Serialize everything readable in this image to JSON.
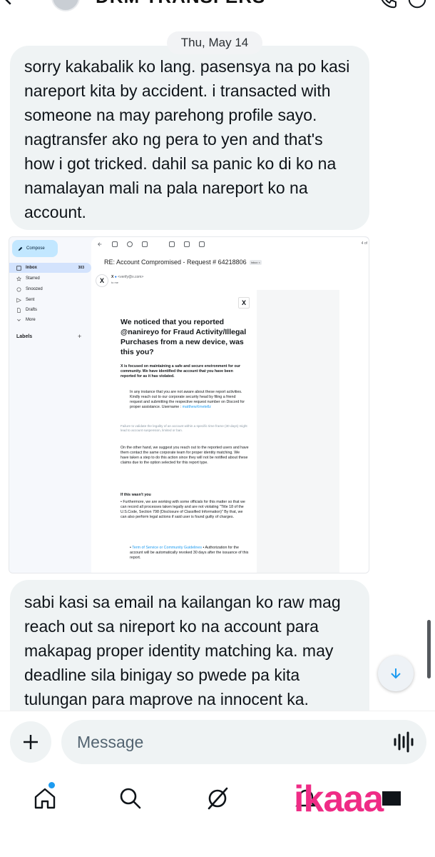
{
  "header": {
    "title": "DKM TRANSFERS"
  },
  "conversation": {
    "date_separator": "Thu, May 14",
    "messages": [
      {
        "text": "sorry kakabalik ko lang. pasensya na po kasi nareport kita by accident. i transacted with someone na may parehong profile sayo. nagtransfer ako ng pera to yen and that's how i got tricked. dahil sa panic ko di ko na namalayan mali na pala nareport ko na account."
      },
      {
        "text": "sabi kasi sa email na kailangan ko raw mag reach out sa nireport ko na account para makapag proper identity matching ka. may deadline sila binigay so pwede pa kita tulungan para maprove na innocent ka."
      }
    ]
  },
  "embedded_screenshot": {
    "compose": "Compose",
    "nav": [
      {
        "label": "Inbox",
        "count": "303",
        "icon": "inbox-icon"
      },
      {
        "label": "Starred",
        "icon": "star-icon"
      },
      {
        "label": "Snoozed",
        "icon": "clock-icon"
      },
      {
        "label": "Sent",
        "icon": "send-icon"
      },
      {
        "label": "Drafts",
        "icon": "draft-icon"
      },
      {
        "label": "More",
        "icon": "chevron-down-icon"
      }
    ],
    "labels_heading": "Labels",
    "labels_add": "+",
    "page_counter": "4 of",
    "subject": "RE: Account Compromised - Request # 64218806",
    "inbox_tag": "Inbox ×",
    "sender_name": "X",
    "sender_email": "<verify@x.com>",
    "recipient": "to me",
    "email": {
      "logo": "X",
      "headline": "We noticed that you reported @nanireyo for Fraud Activity/Illegal Purchases from a new device, was this you?",
      "intro": "X is focused on maintaining a safe and secure environment for our community. We have identified the account that you have been reported for as it has violated.",
      "instructions": "In any instance that you are not aware about these report activities. Kindly reach out to our corporate security head by filing a friend request and submitting the respective request number on Discord for proper assistance.",
      "username_label": "Username",
      "username_value": "matthewXmetellz",
      "warning": "Failure to validate the legality of an account within a specific time frame (30 days) might lead to account suspension, limited or ban.",
      "other_hand": "On the other hand, we suggest you reach out to the reported users and have them contact the same corporate team for proper identity matching. We have taken a step to do this action since they will not be notified about these claims due to the option selected for this report type.",
      "if_not_you_heading": "If this wasn't you",
      "furthermore": "• Furthermore, we are working with some officials for this matter so that we can record all processes taken legally and are not violating \"Title 18 of the U.S.Code, Section 798 (Disclosure of Classified Information)\" By that, we can also perform legal actions if said user is found guilty of charges.",
      "tos_link": "Term of Service or Community Guidelines",
      "tos_text": "Authorization for the account will be automatically revoked 30 days after the issuance of this report."
    }
  },
  "composer": {
    "placeholder": "Message"
  },
  "watermark": "ikaaa",
  "colors": {
    "bubble": "#eff3f4",
    "accent": "#1d9bf0",
    "watermark": "#ef2c86"
  }
}
